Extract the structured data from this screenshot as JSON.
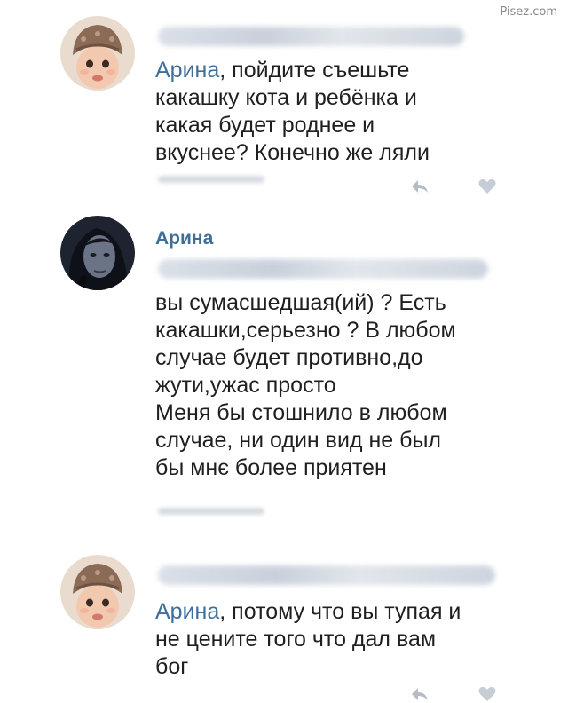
{
  "watermark": "Pisez.com",
  "comments": [
    {
      "mention": "Арина",
      "text": ", пойдите съешьте\nкакашку кота и ребёнка и\nкакая будет роднее и\nвкуснее? Конечно же ляли",
      "avatar_icon": "baby-avatar-icon",
      "actions": [
        "reply-icon",
        "like-icon"
      ]
    },
    {
      "author": "Арина",
      "text": "вы сумасшедшая(ий) ? Есть\nкакашки,серьезно ? В любом\nслучае будет противно,до\nжути,ужас просто\nМеня бы стошнило в любом\nслучае, ни один вид не был\nбы мнє более приятен",
      "avatar_icon": "girl-avatar-icon"
    },
    {
      "mention": "Арина",
      "text": ", потому что вы тупая и\nне цените того что дал вам\nбог",
      "avatar_icon": "baby-avatar-icon",
      "actions": [
        "reply-icon",
        "like-icon"
      ]
    }
  ],
  "colors": {
    "mention": "#3f6e99",
    "text": "#1f1f1f",
    "blurred_name": "#c4ccd8"
  }
}
